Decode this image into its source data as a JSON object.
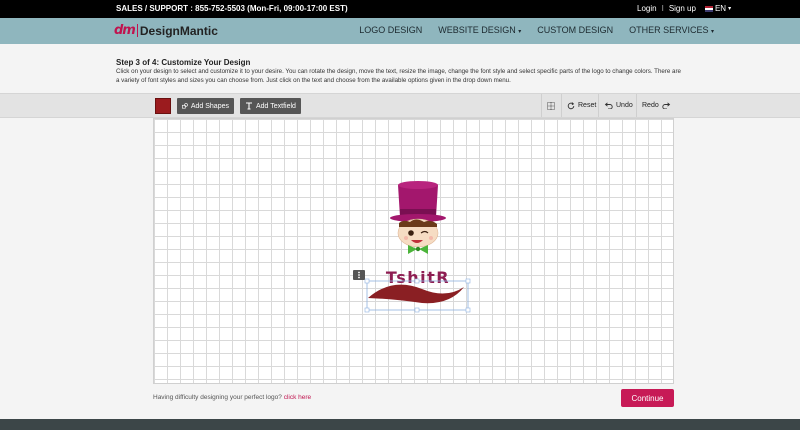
{
  "topbar": {
    "sales": "SALES / SUPPORT : 855-752-5503 (Mon-Fri, 09:00-17:00 EST)",
    "login": "Login",
    "separator": "I",
    "signup": "Sign up",
    "lang": "EN"
  },
  "brand": {
    "mark": "dm",
    "name": "DesignMantic"
  },
  "nav": [
    {
      "label": "LOGO DESIGN",
      "caret": ""
    },
    {
      "label": "WEBSITE DESIGN",
      "caret": "▾"
    },
    {
      "label": "CUSTOM DESIGN",
      "caret": ""
    },
    {
      "label": "OTHER SERVICES",
      "caret": "▾"
    }
  ],
  "step": {
    "title": "Step 3 of 4: Customize Your Design",
    "description": "Click on your design to select and customize it to your desire. You can rotate the design, move the text, resize the image, change the font style and select specific parts of the logo to change colors. There are a variety of font styles and sizes you can choose from. Just click on the text and choose from the available options given in the drop down menu."
  },
  "toolbar": {
    "selected_color": "#9b1b1e",
    "add_shapes": "Add Shapes",
    "add_textfield": "Add Textfield",
    "reset": "Reset",
    "undo": "Undo",
    "redo": "Redo"
  },
  "design": {
    "text": "TshitR",
    "text_color": "#8e1d52",
    "hat_color": "#a3176d",
    "swoosh_color": "#8a1f23",
    "bowtie_color": "#4bb43a"
  },
  "help": {
    "text": "Having difficulty designing your perfect logo?",
    "link": "click here"
  },
  "continue": "Continue",
  "colors": {
    "accent": "#c71a56",
    "navbar": "#8fb6be"
  }
}
